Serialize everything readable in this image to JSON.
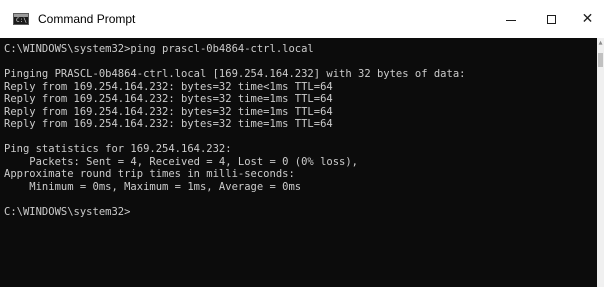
{
  "window": {
    "title": "Command Prompt",
    "icon": "cmd-console-icon",
    "icon_glyph": "C:\\",
    "controls": {
      "minimize": "minimize-icon",
      "maximize": "maximize-icon",
      "close_glyph": "✕"
    }
  },
  "colors": {
    "console_background": "#0c0c0c",
    "console_text": "#cccccc",
    "titlebar_background": "#ffffff"
  },
  "console": {
    "lines": [
      "C:\\WINDOWS\\system32>ping prascl-0b4864-ctrl.local",
      "",
      "Pinging PRASCL-0b4864-ctrl.local [169.254.164.232] with 32 bytes of data:",
      "Reply from 169.254.164.232: bytes=32 time<1ms TTL=64",
      "Reply from 169.254.164.232: bytes=32 time=1ms TTL=64",
      "Reply from 169.254.164.232: bytes=32 time=1ms TTL=64",
      "Reply from 169.254.164.232: bytes=32 time=1ms TTL=64",
      "",
      "Ping statistics for 169.254.164.232:",
      "    Packets: Sent = 4, Received = 4, Lost = 0 (0% loss),",
      "Approximate round trip times in milli-seconds:",
      "    Minimum = 0ms, Maximum = 1ms, Average = 0ms",
      "",
      "C:\\WINDOWS\\system32>"
    ]
  }
}
